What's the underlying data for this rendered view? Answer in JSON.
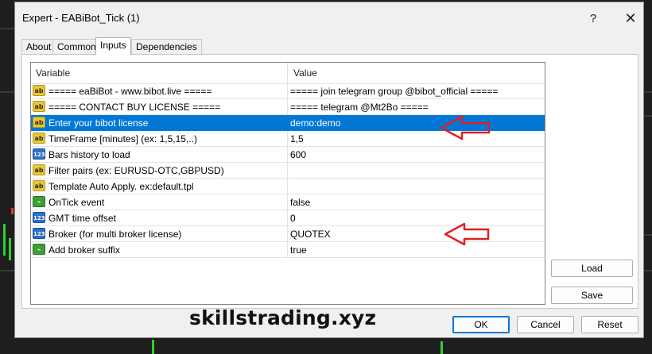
{
  "window": {
    "title": "Expert - EABiBot_Tick (1)",
    "help_glyph": "?",
    "close_glyph": "✕"
  },
  "tabs": [
    {
      "label": "About"
    },
    {
      "label": "Common"
    },
    {
      "label": "Inputs",
      "active": true
    },
    {
      "label": "Dependencies"
    }
  ],
  "grid": {
    "columns": {
      "variable": "Variable",
      "value": "Value"
    },
    "rows": [
      {
        "type": "ab",
        "variable": "===== eaBiBot - www.bibot.live =====",
        "value": "===== join telegram group @bibot_official ====="
      },
      {
        "type": "ab",
        "variable": "===== CONTACT BUY LICENSE =====",
        "value": "===== telegram @Mt2Bo ====="
      },
      {
        "type": "ab",
        "variable": "Enter your bibot license",
        "value": "demo:demo",
        "selected": true
      },
      {
        "type": "ab",
        "variable": "TimeFrame [minutes] (ex: 1,5,15,..)",
        "value": "1,5"
      },
      {
        "type": "num",
        "variable": "Bars history to load",
        "value": "600"
      },
      {
        "type": "ab",
        "variable": "Filter pairs (ex: EURUSD-OTC,GBPUSD)",
        "value": ""
      },
      {
        "type": "ab",
        "variable": "Template Auto Apply. ex:default.tpl",
        "value": ""
      },
      {
        "type": "bool",
        "variable": "OnTick event",
        "value": "false"
      },
      {
        "type": "num",
        "variable": "GMT time offset",
        "value": "0"
      },
      {
        "type": "num",
        "variable": "Broker (for multi broker license)",
        "value": "QUOTEX"
      },
      {
        "type": "bool",
        "variable": "Add broker suffix",
        "value": "true"
      }
    ],
    "icon_text": {
      "ab": "ab",
      "num": "123",
      "bool": "⌁"
    }
  },
  "buttons": {
    "load": "Load",
    "save": "Save",
    "ok": "OK",
    "cancel": "Cancel",
    "reset": "Reset"
  },
  "watermark": "skillstrading.xyz",
  "colors": {
    "selection": "#0078d7",
    "arrow": "#e02020",
    "background_chart": "#1e1e1e"
  }
}
